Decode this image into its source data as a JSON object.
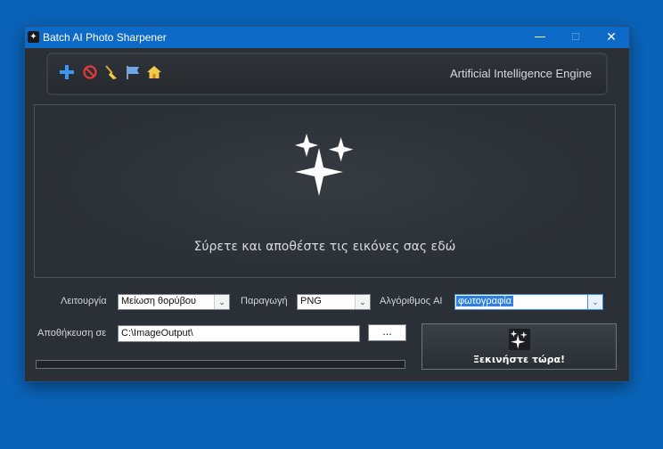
{
  "window": {
    "title": "Batch AI Photo Sharpener",
    "minimize_glyph": "—",
    "maximize_glyph": "☐",
    "close_glyph": "✕"
  },
  "toolbar": {
    "icons": [
      "add-icon",
      "remove-icon",
      "clear-broom-icon",
      "folder-flag-icon",
      "home-icon"
    ],
    "engine_label": "Artificial Intelligence Engine"
  },
  "dropzone": {
    "icon": "sparkles-icon",
    "text": "Σύρετε και αποθέστε τις εικόνες σας εδώ"
  },
  "options": {
    "mode_label": "Λειτουργία",
    "mode_value": "Μείωση θορύβου",
    "output_label": "Παραγωγή",
    "output_value": "PNG",
    "algorithm_label": "Αλγόριθμος AI",
    "algorithm_value": "φωτογραφία",
    "save_label": "Αποθήκευση σε",
    "save_path": "C:\\ImageOutput\\",
    "browse_label": "..."
  },
  "progress": {
    "value": 0
  },
  "start": {
    "label": "Ξεκινήστε τώρα!",
    "icon": "sparkles-icon"
  },
  "colors": {
    "desktop": "#0a63b8",
    "titlebar": "#0d6ac6",
    "window_bg": "#2b3036",
    "highlight": "#2f7fe0"
  }
}
